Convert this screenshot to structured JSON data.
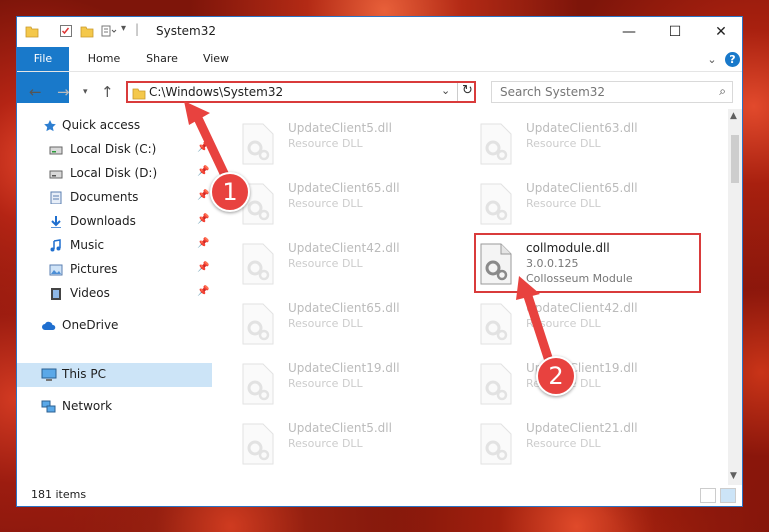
{
  "window": {
    "title": "System32",
    "controls": {
      "minimize": "—",
      "maximize": "☐",
      "close": "✕"
    }
  },
  "ribbon": {
    "tabs": [
      "File",
      "Home",
      "Share",
      "View"
    ],
    "help": "?"
  },
  "address": {
    "path": "C:\\Windows\\System32",
    "refresh": "↻"
  },
  "search": {
    "placeholder": "Search System32"
  },
  "sidebar": {
    "items": [
      {
        "label": "Quick access",
        "icon": "star-icon"
      },
      {
        "label": "Local Disk (C:)",
        "icon": "drive-icon",
        "pinned": true
      },
      {
        "label": "Local Disk (D:)",
        "icon": "drive-icon",
        "pinned": true
      },
      {
        "label": "Documents",
        "icon": "documents-icon",
        "pinned": true
      },
      {
        "label": "Downloads",
        "icon": "download-icon",
        "pinned": true
      },
      {
        "label": "Music",
        "icon": "music-icon",
        "pinned": true
      },
      {
        "label": "Pictures",
        "icon": "pictures-icon",
        "pinned": true
      },
      {
        "label": "Videos",
        "icon": "videos-icon",
        "pinned": true
      },
      {
        "label": "OneDrive",
        "icon": "cloud-icon"
      },
      {
        "label": "This PC",
        "icon": "pc-icon",
        "selected": true
      },
      {
        "label": "Network",
        "icon": "network-icon"
      }
    ]
  },
  "files": [
    {
      "name": "UpdateClient5.dll",
      "sub": "Resource DLL"
    },
    {
      "name": "UpdateClient63.dll",
      "sub": "Resource DLL"
    },
    {
      "name": "UpdateClient65.dll",
      "sub": "Resource DLL"
    },
    {
      "name": "UpdateClient65.dll",
      "sub": "Resource DLL"
    },
    {
      "name": "UpdateClient42.dll",
      "sub": "Resource DLL"
    },
    {
      "name": "collmodule.dll",
      "sub": "3.0.0.125",
      "sub2": "Collosseum Module"
    },
    {
      "name": "UpdateClient65.dll",
      "sub": "Resource DLL"
    },
    {
      "name": "UpdateClient42.dll",
      "sub": "Resource DLL"
    },
    {
      "name": "UpdateClient19.dll",
      "sub": "Resource DLL"
    },
    {
      "name": "UpdateClient19.dll",
      "sub": "Resource DLL"
    },
    {
      "name": "UpdateClient5.dll",
      "sub": "Resource DLL"
    },
    {
      "name": "UpdateClient21.dll",
      "sub": "Resource DLL"
    }
  ],
  "status": {
    "count": "181 items"
  },
  "annotations": [
    {
      "label": "1"
    },
    {
      "label": "2"
    }
  ],
  "colors": {
    "accent": "#1979ca",
    "highlight": "#d93b3b",
    "badge": "#e8423f",
    "selected": "#cce4f7"
  }
}
